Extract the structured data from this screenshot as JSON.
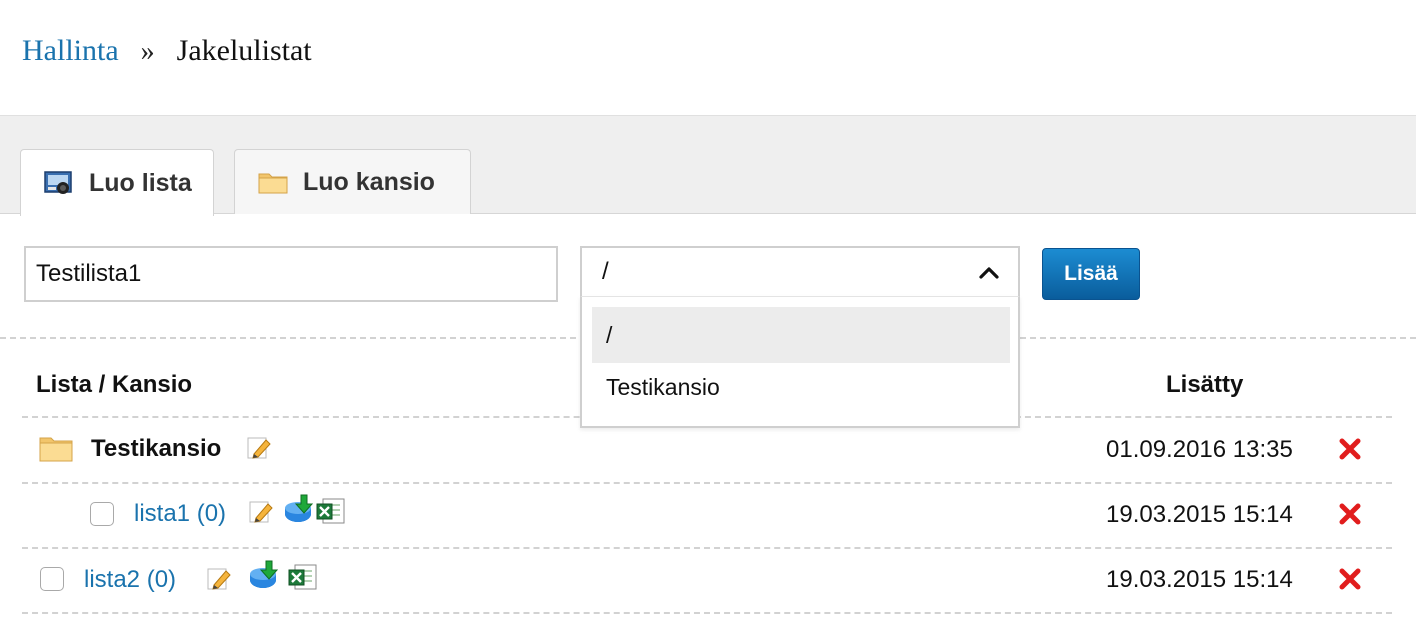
{
  "breadcrumb": {
    "parent": "Hallinta",
    "separator": "»",
    "current": "Jakelulistat"
  },
  "tabs": [
    {
      "label": "Luo lista",
      "icon": "list-icon",
      "active": true
    },
    {
      "label": "Luo kansio",
      "icon": "folder-icon",
      "active": false
    }
  ],
  "form": {
    "name_value": "Testilista1",
    "folder_selected": "/",
    "folder_options": [
      "/",
      "Testikansio"
    ],
    "folder_highlighted": "/",
    "add_button": "Lisää"
  },
  "table": {
    "headers": {
      "name": "Lista / Kansio",
      "added": "Lisätty"
    },
    "rows": [
      {
        "type": "folder",
        "name": "Testikansio",
        "added": "01.09.2016 13:35"
      },
      {
        "type": "list",
        "name": "lista1 (0)",
        "added": "19.03.2015 15:14",
        "in_folder": true
      },
      {
        "type": "list",
        "name": "lista2 (0)",
        "added": "19.03.2015 15:14",
        "in_folder": false
      }
    ]
  },
  "colors": {
    "link": "#1a73ad",
    "button": "#0a5d9c",
    "delete": "#e11d1d",
    "tabstrip": "#efefef"
  },
  "icons": [
    "list-icon",
    "folder-icon",
    "chevron-up-icon",
    "edit-icon",
    "download-icon",
    "excel-icon",
    "delete-icon"
  ]
}
